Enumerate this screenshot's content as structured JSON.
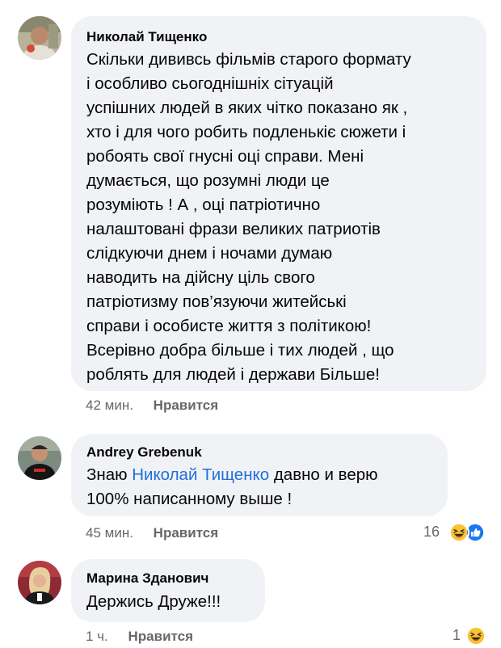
{
  "comments": [
    {
      "author": "Николай Тищенко",
      "lines": [
        "Скільки дививсь фільмів старого формату",
        "і особливо сьогоднішніх сітуацій",
        "успішних людей в яких чітко показано як ,",
        "хто і для чого робить подленькіє сюжети і",
        "робоять свої гнусні оці справи. Мені",
        "думається, що розумні люди це",
        "розуміють ! А , оці патріотично",
        "налаштовані фрази великих патриотів",
        "слідкуючи днем і ночами думаю",
        "наводить на дійсну ціль свого",
        "патріотизму  пов’язуючи житейські",
        "справи і особисте життя з політикою!",
        "Всерівно добра більше і тих людей , що",
        "роблять для людей і держави Більше!"
      ],
      "time": "42 мин.",
      "like_label": "Нравится"
    },
    {
      "author": "Andrey Grebenuk",
      "line1_prefix": "Знаю ",
      "mention": "Николай Тищенко",
      "line1_suffix": " давно и верю",
      "line2": "100% написанному выше !",
      "time": "45 мин.",
      "like_label": "Нравится",
      "reaction_count": "16",
      "reactions": [
        "laugh-emoji",
        "like-emoji"
      ]
    },
    {
      "author": "Марина Зданович",
      "text": "Держись Друже!!!",
      "time": "1 ч.",
      "like_label": "Нравится",
      "reaction_count": "1",
      "reactions": [
        "laugh-emoji"
      ]
    }
  ],
  "colors": {
    "bubble": "#f0f2f5",
    "mention": "#216fdb",
    "meta": "#65676b",
    "like_blue": "#1877f2",
    "haha_yellow": "#f7c233"
  }
}
